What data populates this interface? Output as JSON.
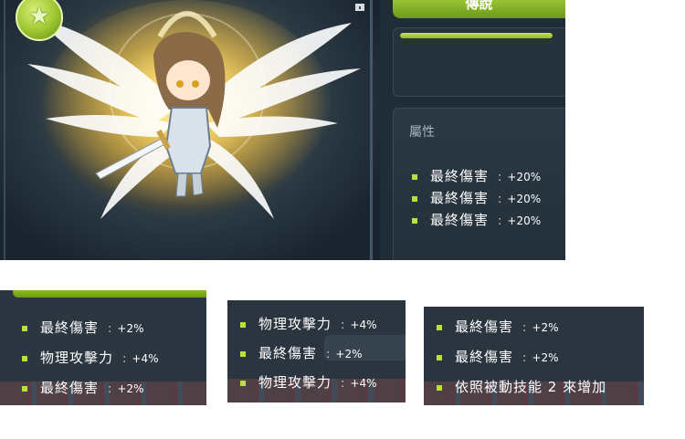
{
  "header": {
    "grade_label": "傳說",
    "grade_color": "#8cbf2a"
  },
  "progress": {
    "fill_percent": 100
  },
  "attributes": {
    "title": "屬性",
    "separator": ":",
    "main_stats": [
      {
        "name": "最終傷害",
        "value": "+20%"
      },
      {
        "name": "最終傷害",
        "value": "+20%"
      },
      {
        "name": "最終傷害",
        "value": "+20%"
      }
    ]
  },
  "potentials": {
    "panel_1": [
      {
        "name": "最終傷害",
        "value": "+2%"
      },
      {
        "name": "物理攻擊力",
        "value": "+4%"
      },
      {
        "name": "最終傷害",
        "value": "+2%"
      }
    ],
    "panel_2": [
      {
        "name": "物理攻擊力",
        "value": "+4%"
      },
      {
        "name": "最終傷害",
        "value": "+2%"
      },
      {
        "name": "物理攻擊力",
        "value": "+4%"
      }
    ],
    "panel_3": [
      {
        "name": "最終傷害",
        "value": "+2%"
      },
      {
        "name": "最終傷害",
        "value": "+2%"
      }
    ],
    "panel_3_note": "依照被動技能 2 來增加"
  },
  "icons": {
    "grade": "star-icon",
    "lock": "lock-icon",
    "bullet": "square-bullet-icon"
  }
}
